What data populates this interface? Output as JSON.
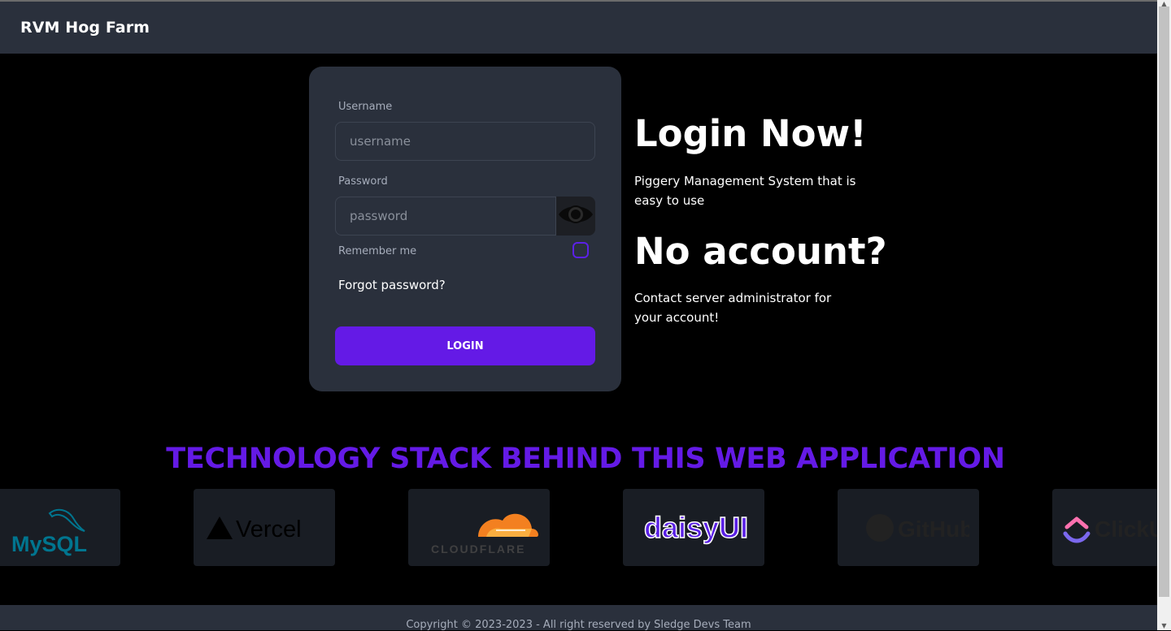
{
  "navbar": {
    "brand": "RVM Hog Farm"
  },
  "login_form": {
    "username_label": "Username",
    "username_placeholder": "username",
    "password_label": "Password",
    "password_placeholder": "password",
    "remember_label": "Remember me",
    "forgot_label": "Forgot password?",
    "login_label": "LOGIN"
  },
  "info": {
    "login_heading": "Login Now!",
    "login_text": "Piggery Management System that is easy to use",
    "account_heading": "No account?",
    "account_text": "Contact server administrator for your account!"
  },
  "tech": {
    "title": "TECHNOLOGY STACK BEHIND THIS WEB APPLICATION",
    "logos": [
      "MySQL",
      "Vercel",
      "CLOUDFLARE",
      "daisyUI",
      "GitHub",
      "ClickUp"
    ]
  },
  "footer": {
    "copyright": "Copyright © 2023-2023 - All right reserved by Sledge Devs Team"
  },
  "colors": {
    "primary": "#641ae6",
    "surface": "#2a303c",
    "tile": "#191d24"
  },
  "icons": {
    "password_toggle": "eye-icon"
  }
}
